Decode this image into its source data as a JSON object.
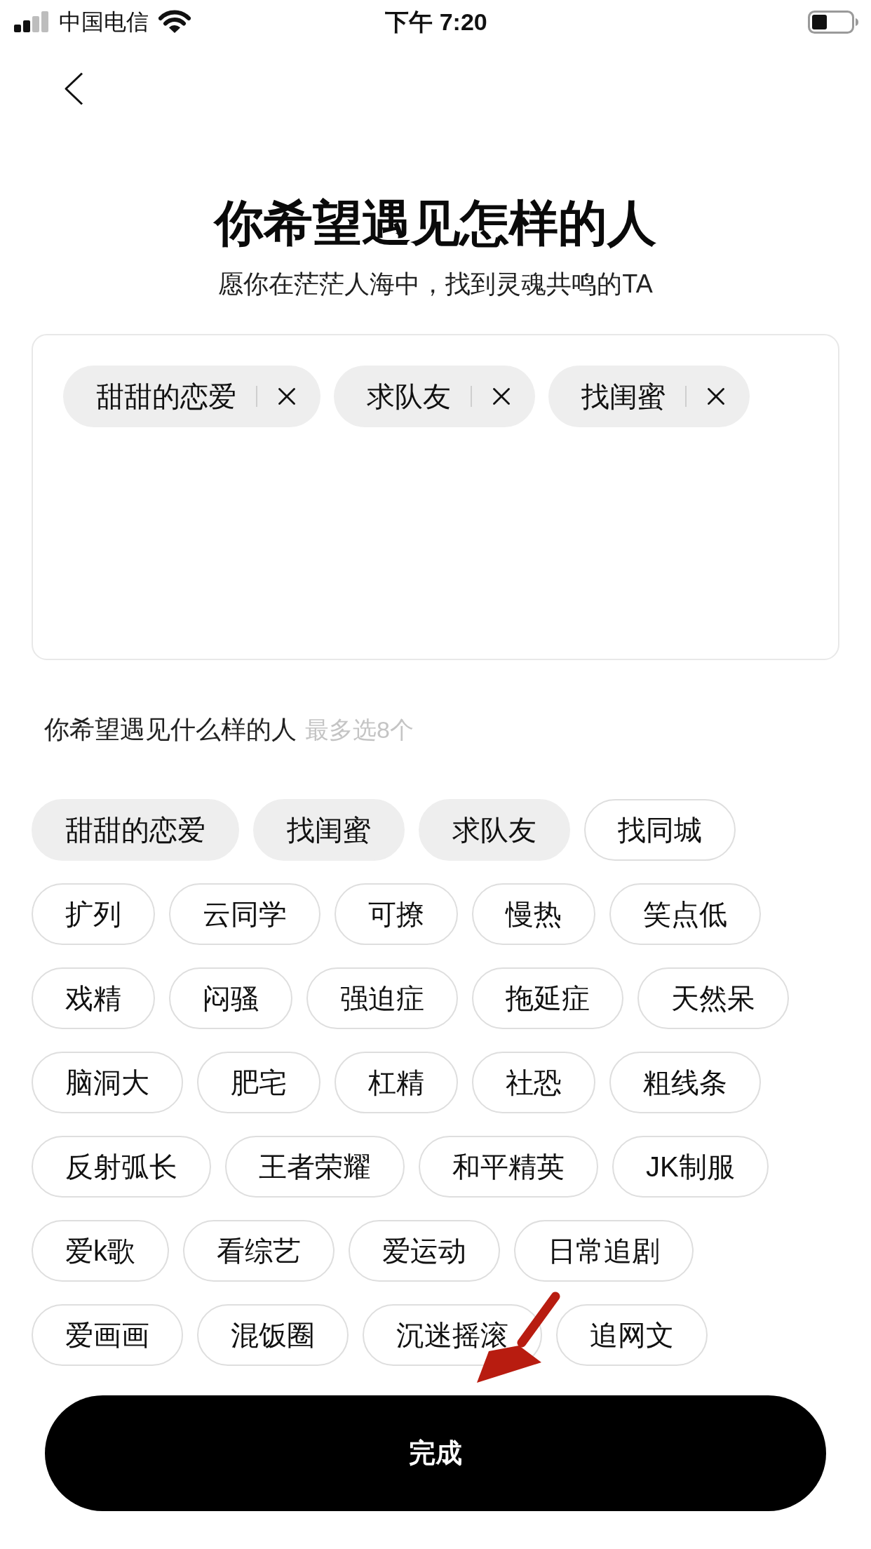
{
  "status_bar": {
    "carrier": "中国电信",
    "time": "下午 7:20"
  },
  "header": {
    "title": "你希望遇见怎样的人",
    "subtitle": "愿你在茫茫人海中，找到灵魂共鸣的TA"
  },
  "selected_tags": [
    {
      "label": "甜甜的恋爱"
    },
    {
      "label": "求队友"
    },
    {
      "label": "找闺蜜"
    }
  ],
  "picker": {
    "label": "你希望遇见什么样的人",
    "hint": "最多选8个",
    "tags": [
      {
        "label": "甜甜的恋爱",
        "selected": true
      },
      {
        "label": "找闺蜜",
        "selected": true
      },
      {
        "label": "求队友",
        "selected": true
      },
      {
        "label": "找同城",
        "selected": false
      },
      {
        "label": "扩列",
        "selected": false
      },
      {
        "label": "云同学",
        "selected": false
      },
      {
        "label": "可撩",
        "selected": false
      },
      {
        "label": "慢热",
        "selected": false
      },
      {
        "label": "笑点低",
        "selected": false
      },
      {
        "label": "戏精",
        "selected": false
      },
      {
        "label": "闷骚",
        "selected": false
      },
      {
        "label": "强迫症",
        "selected": false
      },
      {
        "label": "拖延症",
        "selected": false
      },
      {
        "label": "天然呆",
        "selected": false
      },
      {
        "label": "脑洞大",
        "selected": false
      },
      {
        "label": "肥宅",
        "selected": false
      },
      {
        "label": "杠精",
        "selected": false
      },
      {
        "label": "社恐",
        "selected": false
      },
      {
        "label": "粗线条",
        "selected": false
      },
      {
        "label": "反射弧长",
        "selected": false
      },
      {
        "label": "王者荣耀",
        "selected": false
      },
      {
        "label": "和平精英",
        "selected": false
      },
      {
        "label": "JK制服",
        "selected": false
      },
      {
        "label": "爱k歌",
        "selected": false
      },
      {
        "label": "看综艺",
        "selected": false
      },
      {
        "label": "爱运动",
        "selected": false
      },
      {
        "label": "日常追剧",
        "selected": false
      },
      {
        "label": "爱画画",
        "selected": false
      },
      {
        "label": "混饭圈",
        "selected": false
      },
      {
        "label": "沉迷摇滚",
        "selected": false
      },
      {
        "label": "追网文",
        "selected": false
      }
    ]
  },
  "done_button": {
    "label": "完成"
  }
}
